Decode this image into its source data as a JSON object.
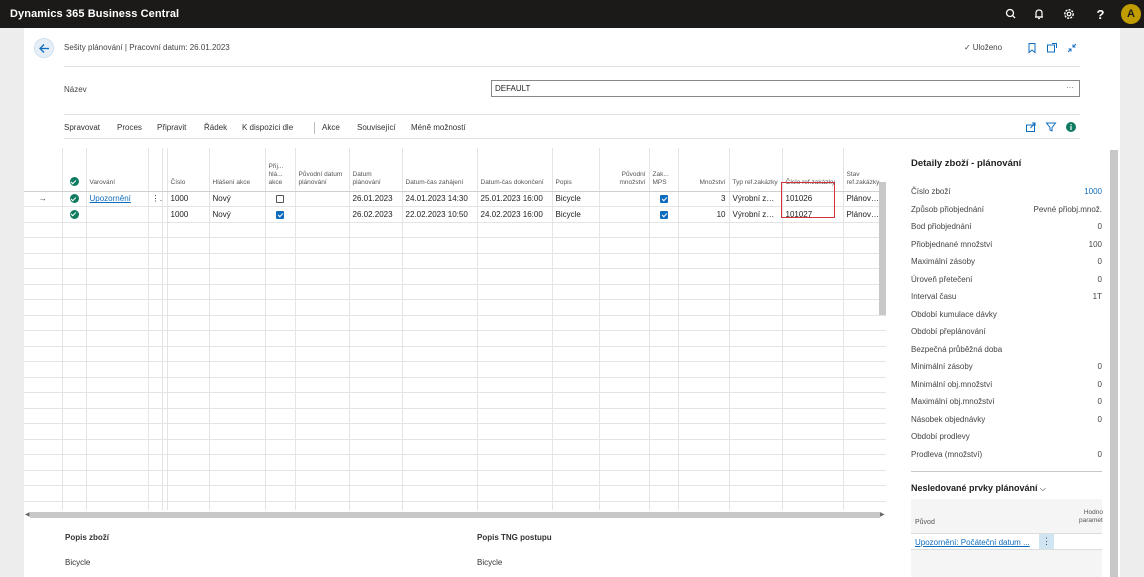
{
  "app": {
    "title": "Dynamics 365 Business Central",
    "user_initial": "A"
  },
  "page": {
    "breadcrumb": "Sešity plánování | Pracovní datum: 26.01.2023",
    "saved": "Uloženo",
    "name_label": "Název",
    "name_value": "DEFAULT",
    "name_more": "···"
  },
  "actions": [
    "Spravovat",
    "Proces",
    "Připravit",
    "Řádek",
    "K dispozici dle",
    "Akce",
    "Související",
    "Méně možností"
  ],
  "grid": {
    "headers": {
      "warning": "Varování",
      "number": "Číslo",
      "action_msg": "Hlášení akce",
      "accept": "Přij... hlá... akce",
      "orig_date": "Původní datum plánování",
      "plan_date": "Datum plánování",
      "start": "Datum-čas zahájení",
      "end": "Datum-čas dokončení",
      "desc": "Popis",
      "orig_qty": "Původní množství",
      "mps": "Zak... MPS",
      "qty": "Množství",
      "ref_type": "Typ ref.zakázky",
      "ref_no": "Číslo ref.zakázky",
      "status": "Stav ref.zakázky"
    },
    "rows": [
      {
        "warning": "Upozornění",
        "number": "1000",
        "action_msg": "Nový",
        "accept": false,
        "orig_date": "",
        "plan_date": "26.01.2023",
        "start": "24.01.2023 14:30",
        "end": "25.01.2023 16:00",
        "desc": "Bicycle",
        "orig_qty": "",
        "mps": true,
        "qty": "3",
        "ref_type": "Výrobní zak...",
        "ref_no": "101026",
        "status": "Plánovaná"
      },
      {
        "warning": "",
        "number": "1000",
        "action_msg": "Nový",
        "accept": true,
        "orig_date": "",
        "plan_date": "26.02.2023",
        "start": "22.02.2023 10:50",
        "end": "24.02.2023 16:00",
        "desc": "Bicycle",
        "orig_qty": "",
        "mps": true,
        "qty": "10",
        "ref_type": "Výrobní zak...",
        "ref_no": "101027",
        "status": "Plánovaná"
      }
    ],
    "empty_rows": 19
  },
  "factbox": {
    "title": "Detaily zboží - plánování",
    "rows": [
      {
        "label": "Číslo zboží",
        "value": "1000",
        "link": true
      },
      {
        "label": "Způsob přiobjednání",
        "value": "Pevné přiobj.množ."
      },
      {
        "label": "Bod přiobjednání",
        "value": "0"
      },
      {
        "label": "Přiobjednané množství",
        "value": "100"
      },
      {
        "label": "Maximální zásoby",
        "value": "0"
      },
      {
        "label": "Úroveň přetečení",
        "value": "0"
      },
      {
        "label": "Interval času",
        "value": "1T"
      },
      {
        "label": "Období kumulace dávky",
        "value": ""
      },
      {
        "label": "Období přeplánování",
        "value": ""
      },
      {
        "label": "Bezpečná průběžná doba",
        "value": ""
      },
      {
        "label": "Minimální zásoby",
        "value": "0"
      },
      {
        "label": "Minimální obj.množství",
        "value": "0"
      },
      {
        "label": "Maximální obj.množství",
        "value": "0"
      },
      {
        "label": "Násobek objednávky",
        "value": "0"
      },
      {
        "label": "Období prodlevy",
        "value": ""
      },
      {
        "label": "Prodleva (množství)",
        "value": "0"
      }
    ],
    "untracked_title": "Nesledované prvky plánování",
    "untracked_col1": "Původ",
    "untracked_col2": "Hodno parametr",
    "untracked_link": "Upozornění: Počáteční datum ...",
    "untracked_menu": "⋮"
  },
  "bottom": {
    "item_desc_label": "Popis zboží",
    "item_desc_value": "Bicycle",
    "routing_label": "Popis TNG postupu",
    "routing_value": "Bicycle"
  }
}
